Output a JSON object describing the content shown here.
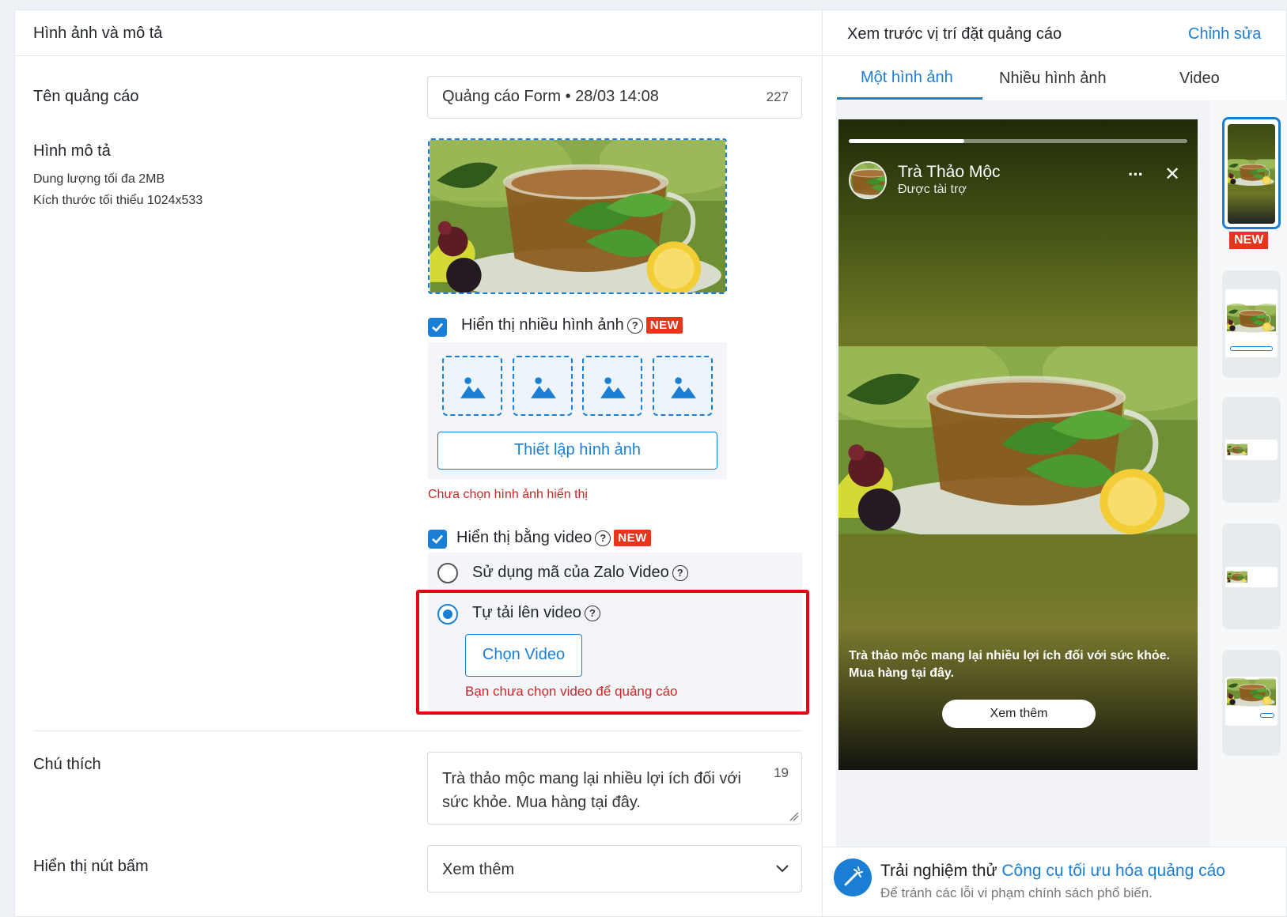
{
  "left": {
    "section_title": "Hình ảnh và mô tả",
    "ad_name": {
      "label": "Tên quảng cáo",
      "value": "Quảng cáo Form • 28/03 14:08",
      "count": "227"
    },
    "image": {
      "label": "Hình mô tả",
      "hint_size": "Dung lượng tối đa 2MB",
      "hint_dim": "Kích thước tối thiểu 1024x533"
    },
    "multi_image": {
      "label": "Hiển thị nhiều hình ảnh",
      "badge": "NEW",
      "setup_button": "Thiết lập hình ảnh",
      "error": "Chưa chọn hình ảnh hiển thị"
    },
    "video": {
      "label": "Hiển thị bằng video",
      "badge": "NEW",
      "option_zalo": "Sử dụng mã của Zalo Video",
      "option_upload": "Tự tải lên video",
      "choose_button": "Chọn Video",
      "error": "Bạn chưa chọn video để quảng cáo"
    },
    "caption": {
      "label": "Chú thích",
      "value": "Trà thảo mộc mang lại nhiều lợi ích đối với sức khỏe. Mua hàng tại đây.",
      "count": "19"
    },
    "cta": {
      "label": "Hiển thị nút bấm",
      "value": "Xem thêm"
    }
  },
  "right": {
    "title": "Xem trước vị trí đặt quảng cáo",
    "edit_link": "Chỉnh sửa",
    "tabs": [
      "Một hình ảnh",
      "Nhiều hình ảnh",
      "Video"
    ],
    "active_tab": 0,
    "preview": {
      "brand": "Trà Thảo Mộc",
      "sponsored": "Được tài trợ",
      "more": "···",
      "close": "✕",
      "caption": "Trà thảo mộc mang lại nhiều lợi ích đối với sức khỏe. Mua hàng tại đây.",
      "cta": "Xem thêm",
      "progress": 0.34
    },
    "thumb_badge": "NEW",
    "tip": {
      "prefix": "Trải nghiệm thử",
      "link": "Công cụ tối ưu hóa quảng cáo",
      "sub": "Để tránh các lỗi vi phạm chính sách phổ biến."
    }
  },
  "colors": {
    "accent": "#1a7fd4",
    "error": "#c62828",
    "badge": "#e8341a",
    "highlight": "#e30613"
  }
}
